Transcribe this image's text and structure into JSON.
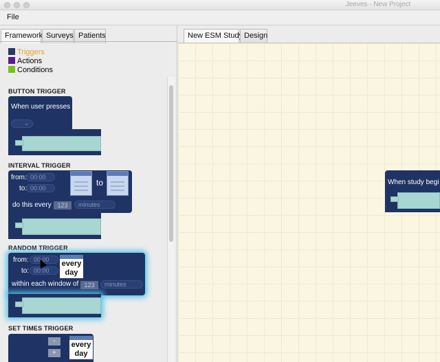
{
  "window": {
    "title": "Jeeves - New Project"
  },
  "menu": {
    "file": "File"
  },
  "left_tabs": [
    "Framework",
    "Surveys",
    "Patients"
  ],
  "legend": [
    {
      "label": "Triggers",
      "color": "#253a6e",
      "label_color": "#e2a12b"
    },
    {
      "label": "Actions",
      "color": "#5b1a94",
      "label_color": "#111111"
    },
    {
      "label": "Conditions",
      "color": "#77c21a",
      "label_color": "#111111"
    }
  ],
  "sections": {
    "button": {
      "title": "BUTTON TRIGGER",
      "text": "When user presses"
    },
    "interval": {
      "title": "INTERVAL TRIGGER",
      "from_label": "from:",
      "from_value": "00:00",
      "to_label": "to:",
      "to_value": "00:00",
      "between": "to",
      "repeat_label": "do this every",
      "repeat_value": "123",
      "unit": "minutes"
    },
    "random": {
      "title": "RANDOM TRIGGER",
      "from_label": "from:",
      "from_value": "00:00",
      "to_label": "to:",
      "to_value": "00:00",
      "every_day_line1": "every",
      "every_day_line2": "day",
      "window_label": "within each window of",
      "window_value": "123",
      "unit": "minutes"
    },
    "settimes": {
      "title": "SET TIMES TRIGGER",
      "minus": "-",
      "plus": "+",
      "every_day_line1": "every",
      "every_day_line2": "day"
    }
  },
  "right_tabs": [
    "New ESM Study",
    "Design"
  ],
  "canvas_block": {
    "text": "When study begi"
  }
}
